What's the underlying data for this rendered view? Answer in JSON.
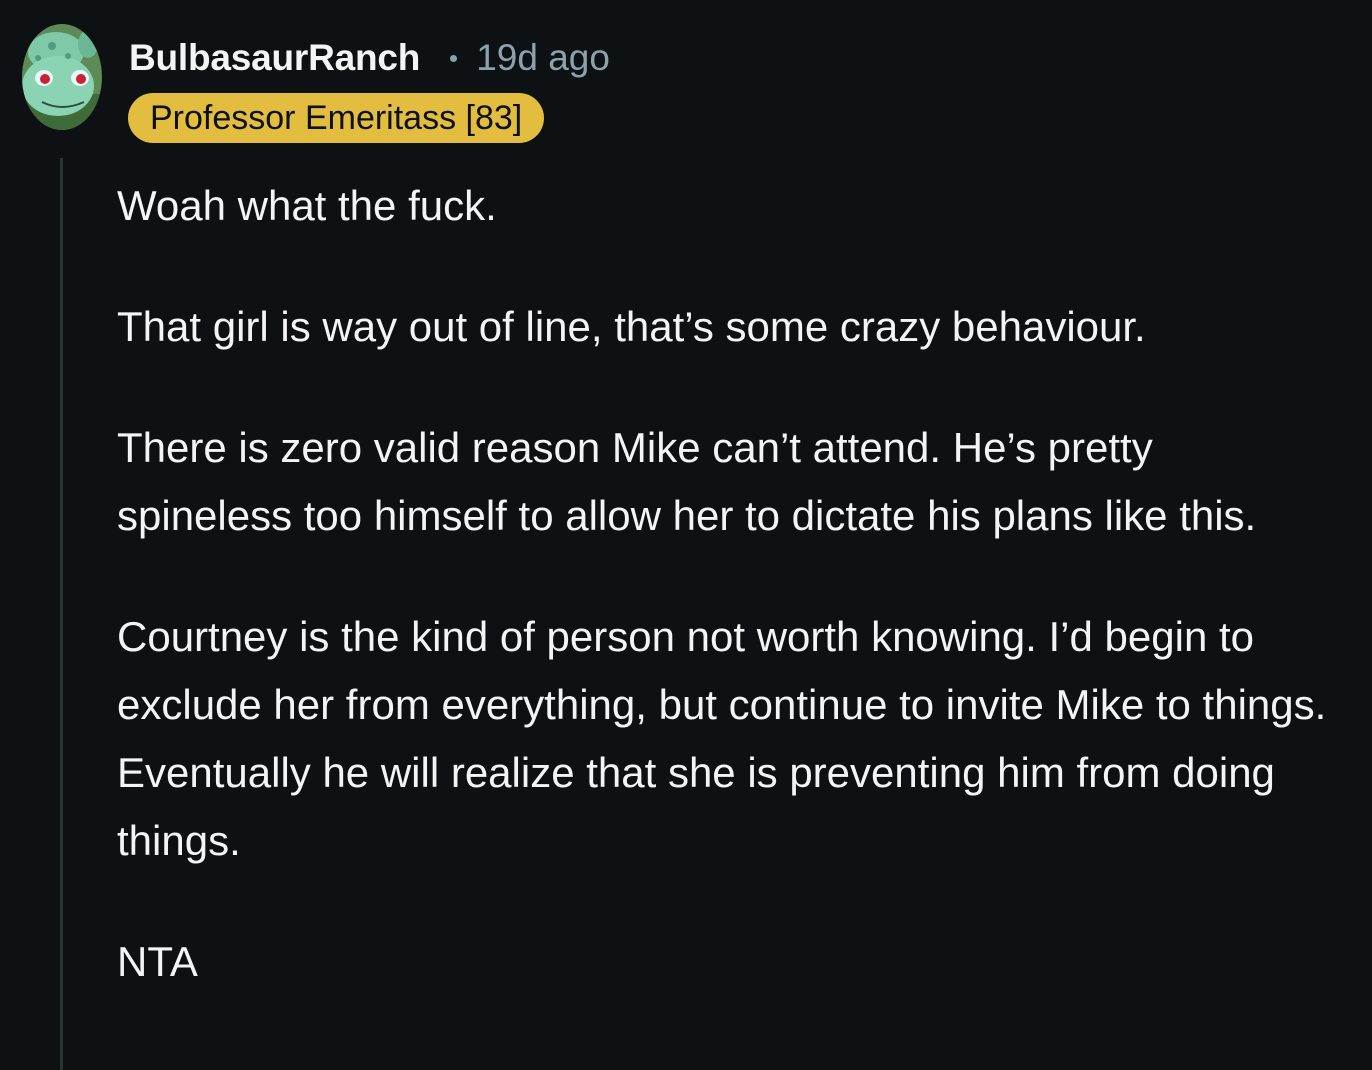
{
  "comment": {
    "author": "BulbasaurRanch",
    "separator": "•",
    "timestamp": "19d ago",
    "flair": "Professor Emeritass [83]",
    "avatar_icon": "bulbasaur-avatar-icon",
    "flair_color": "#e2bd3f",
    "background_color": "#0e1113",
    "paragraphs": [
      "Woah what the fuck.",
      "That girl is way out of line, that’s some crazy behaviour.",
      "There is zero valid reason Mike can’t attend. He’s pretty spineless too himself to allow her to dictate his plans like this.",
      "Courtney is the kind of person not worth knowing. I’d begin to exclude her from everything, but continue to invite Mike to things. Eventually he will realize that she is preventing him from doing things.",
      "NTA"
    ]
  }
}
